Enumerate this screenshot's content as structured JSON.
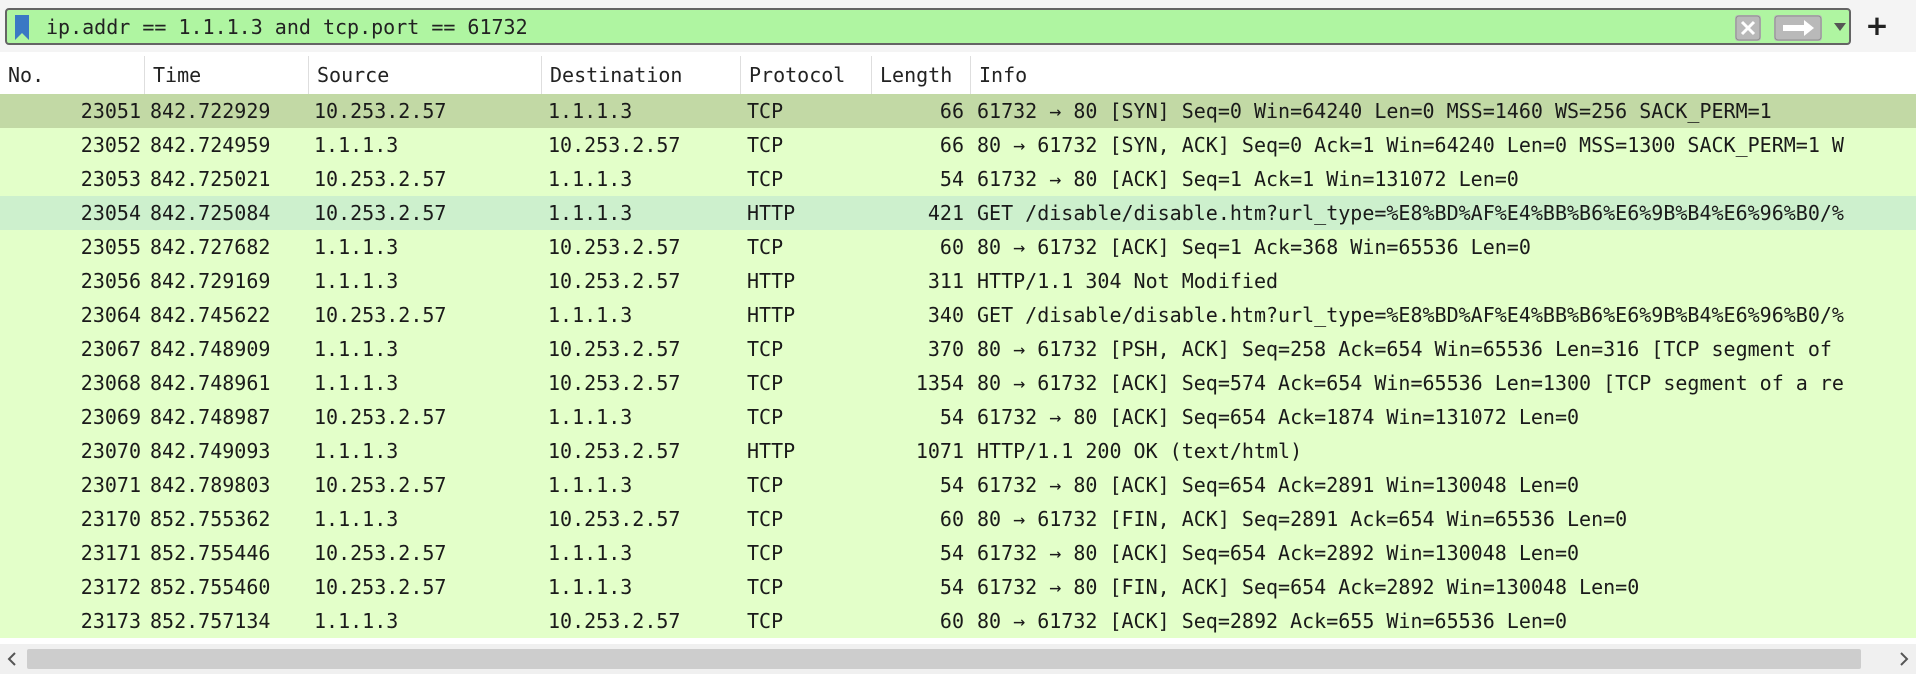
{
  "filter": {
    "value": "ip.addr == 1.1.1.3 and tcp.port == 61732",
    "add_label": "+"
  },
  "columns": [
    "No.",
    "Time",
    "Source",
    "Destination",
    "Protocol",
    "Length",
    "Info"
  ],
  "colors": {
    "filter_valid": "#aff5a1",
    "row_default": "#e3ffc9",
    "row_selected": "#c2d9a5",
    "row_http": "#cdf0cd"
  },
  "packets": [
    {
      "no": "23051",
      "time": "842.722929",
      "src": "10.253.2.57",
      "dst": "1.1.1.3",
      "proto": "TCP",
      "len": "66",
      "info": "61732 → 80 [SYN] Seq=0 Win=64240 Len=0 MSS=1460 WS=256 SACK_PERM=1"
    },
    {
      "no": "23052",
      "time": "842.724959",
      "src": "1.1.1.3",
      "dst": "10.253.2.57",
      "proto": "TCP",
      "len": "66",
      "info": "80 → 61732 [SYN, ACK] Seq=0 Ack=1 Win=64240 Len=0 MSS=1300 SACK_PERM=1 W"
    },
    {
      "no": "23053",
      "time": "842.725021",
      "src": "10.253.2.57",
      "dst": "1.1.1.3",
      "proto": "TCP",
      "len": "54",
      "info": "61732 → 80 [ACK] Seq=1 Ack=1 Win=131072 Len=0"
    },
    {
      "no": "23054",
      "time": "842.725084",
      "src": "10.253.2.57",
      "dst": "1.1.1.3",
      "proto": "HTTP",
      "len": "421",
      "info": "GET /disable/disable.htm?url_type=%E8%BD%AF%E4%BB%B6%E6%9B%B4%E6%96%B0/%"
    },
    {
      "no": "23055",
      "time": "842.727682",
      "src": "1.1.1.3",
      "dst": "10.253.2.57",
      "proto": "TCP",
      "len": "60",
      "info": "80 → 61732 [ACK] Seq=1 Ack=368 Win=65536 Len=0"
    },
    {
      "no": "23056",
      "time": "842.729169",
      "src": "1.1.1.3",
      "dst": "10.253.2.57",
      "proto": "HTTP",
      "len": "311",
      "info": "HTTP/1.1 304 Not Modified"
    },
    {
      "no": "23064",
      "time": "842.745622",
      "src": "10.253.2.57",
      "dst": "1.1.1.3",
      "proto": "HTTP",
      "len": "340",
      "info": "GET /disable/disable.htm?url_type=%E8%BD%AF%E4%BB%B6%E6%9B%B4%E6%96%B0/%"
    },
    {
      "no": "23067",
      "time": "842.748909",
      "src": "1.1.1.3",
      "dst": "10.253.2.57",
      "proto": "TCP",
      "len": "370",
      "info": "80 → 61732 [PSH, ACK] Seq=258 Ack=654 Win=65536 Len=316 [TCP segment of"
    },
    {
      "no": "23068",
      "time": "842.748961",
      "src": "1.1.1.3",
      "dst": "10.253.2.57",
      "proto": "TCP",
      "len": "1354",
      "info": "80 → 61732 [ACK] Seq=574 Ack=654 Win=65536 Len=1300 [TCP segment of a re"
    },
    {
      "no": "23069",
      "time": "842.748987",
      "src": "10.253.2.57",
      "dst": "1.1.1.3",
      "proto": "TCP",
      "len": "54",
      "info": "61732 → 80 [ACK] Seq=654 Ack=1874 Win=131072 Len=0"
    },
    {
      "no": "23070",
      "time": "842.749093",
      "src": "1.1.1.3",
      "dst": "10.253.2.57",
      "proto": "HTTP",
      "len": "1071",
      "info": "HTTP/1.1 200 OK  (text/html)"
    },
    {
      "no": "23071",
      "time": "842.789803",
      "src": "10.253.2.57",
      "dst": "1.1.1.3",
      "proto": "TCP",
      "len": "54",
      "info": "61732 → 80 [ACK] Seq=654 Ack=2891 Win=130048 Len=0"
    },
    {
      "no": "23170",
      "time": "852.755362",
      "src": "1.1.1.3",
      "dst": "10.253.2.57",
      "proto": "TCP",
      "len": "60",
      "info": "80 → 61732 [FIN, ACK] Seq=2891 Ack=654 Win=65536 Len=0"
    },
    {
      "no": "23171",
      "time": "852.755446",
      "src": "10.253.2.57",
      "dst": "1.1.1.3",
      "proto": "TCP",
      "len": "54",
      "info": "61732 → 80 [ACK] Seq=654 Ack=2892 Win=130048 Len=0"
    },
    {
      "no": "23172",
      "time": "852.755460",
      "src": "10.253.2.57",
      "dst": "1.1.1.3",
      "proto": "TCP",
      "len": "54",
      "info": "61732 → 80 [FIN, ACK] Seq=654 Ack=2892 Win=130048 Len=0"
    },
    {
      "no": "23173",
      "time": "852.757134",
      "src": "1.1.1.3",
      "dst": "10.253.2.57",
      "proto": "TCP",
      "len": "60",
      "info": "80 → 61732 [ACK] Seq=2892 Ack=655 Win=65536 Len=0"
    }
  ]
}
